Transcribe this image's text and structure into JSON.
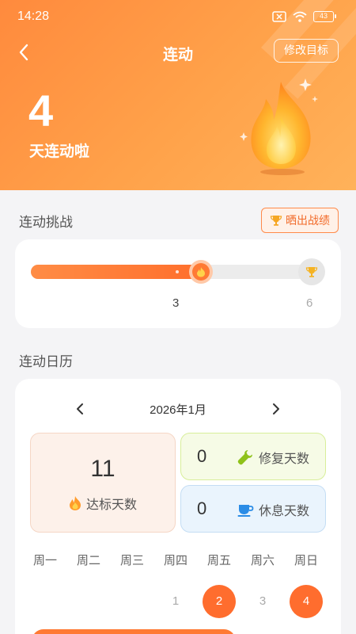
{
  "status_bar": {
    "time": "14:28",
    "battery": "43"
  },
  "nav": {
    "title": "连动",
    "edit_goal_label": "修改目标"
  },
  "streak": {
    "days": "4",
    "label": "天连动啦"
  },
  "challenge": {
    "section_title": "连动挑战",
    "share_label": "晒出战绩",
    "current": 3,
    "goal": 6,
    "current_label": "3",
    "goal_label": "6",
    "progress_fraction": 0.58
  },
  "calendar": {
    "section_title": "连动日历",
    "month_label": "2026年1月",
    "stats": {
      "achieved": {
        "value": "11",
        "label": "达标天数"
      },
      "repair": {
        "value": "0",
        "label": "修复天数"
      },
      "rest": {
        "value": "0",
        "label": "休息天数"
      }
    },
    "weekdays": [
      "周一",
      "周二",
      "周三",
      "周四",
      "周五",
      "周六",
      "周日"
    ],
    "first_row": [
      {
        "label": "",
        "done": false
      },
      {
        "label": "",
        "done": false
      },
      {
        "label": "",
        "done": false
      },
      {
        "label": "1",
        "done": false
      },
      {
        "label": "2",
        "done": true
      },
      {
        "label": "3",
        "done": false
      },
      {
        "label": "4",
        "done": true
      }
    ]
  },
  "colors": {
    "accent": "#ff6d2e",
    "header_start": "#ff8a3d",
    "header_end": "#ffb25a"
  },
  "icons": {
    "back": "chevron-left-icon",
    "flame": "flame-icon",
    "trophy": "trophy-icon",
    "wrench": "wrench-icon",
    "cup": "cup-icon"
  }
}
